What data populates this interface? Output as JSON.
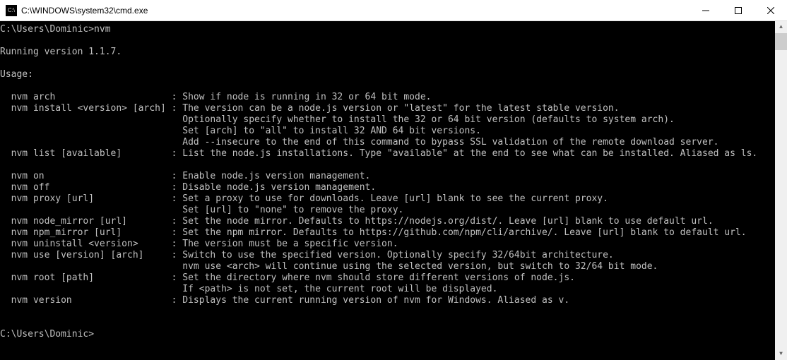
{
  "window": {
    "icon_glyph": "C:\\",
    "title": "C:\\WINDOWS\\system32\\cmd.exe"
  },
  "terminal": {
    "prompt1": "C:\\Users\\Dominic>",
    "cmd1": "nvm",
    "blank": "",
    "running": "Running version 1.1.7.",
    "usage": "Usage:",
    "help": [
      {
        "cmd": "  nvm arch                     ",
        "desc": ": Show if node is running in 32 or 64 bit mode."
      },
      {
        "cmd": "  nvm install <version> [arch] ",
        "desc": ": The version can be a node.js version or \"latest\" for the latest stable version."
      },
      {
        "cmd": "                               ",
        "desc": "  Optionally specify whether to install the 32 or 64 bit version (defaults to system arch)."
      },
      {
        "cmd": "                               ",
        "desc": "  Set [arch] to \"all\" to install 32 AND 64 bit versions."
      },
      {
        "cmd": "                               ",
        "desc": "  Add --insecure to the end of this command to bypass SSL validation of the remote download server."
      },
      {
        "cmd": "  nvm list [available]         ",
        "desc": ": List the node.js installations. Type \"available\" at the end to see what can be installed. Aliased as ls."
      },
      {
        "cmd": "",
        "desc": ""
      },
      {
        "cmd": "  nvm on                       ",
        "desc": ": Enable node.js version management."
      },
      {
        "cmd": "  nvm off                      ",
        "desc": ": Disable node.js version management."
      },
      {
        "cmd": "  nvm proxy [url]              ",
        "desc": ": Set a proxy to use for downloads. Leave [url] blank to see the current proxy."
      },
      {
        "cmd": "                               ",
        "desc": "  Set [url] to \"none\" to remove the proxy."
      },
      {
        "cmd": "  nvm node_mirror [url]        ",
        "desc": ": Set the node mirror. Defaults to https://nodejs.org/dist/. Leave [url] blank to use default url."
      },
      {
        "cmd": "  nvm npm_mirror [url]         ",
        "desc": ": Set the npm mirror. Defaults to https://github.com/npm/cli/archive/. Leave [url] blank to default url."
      },
      {
        "cmd": "  nvm uninstall <version>      ",
        "desc": ": The version must be a specific version."
      },
      {
        "cmd": "  nvm use [version] [arch]     ",
        "desc": ": Switch to use the specified version. Optionally specify 32/64bit architecture."
      },
      {
        "cmd": "                               ",
        "desc": "  nvm use <arch> will continue using the selected version, but switch to 32/64 bit mode."
      },
      {
        "cmd": "  nvm root [path]              ",
        "desc": ": Set the directory where nvm should store different versions of node.js."
      },
      {
        "cmd": "                               ",
        "desc": "  If <path> is not set, the current root will be displayed."
      },
      {
        "cmd": "  nvm version                  ",
        "desc": ": Displays the current running version of nvm for Windows. Aliased as v."
      }
    ],
    "prompt2": "C:\\Users\\Dominic>"
  }
}
